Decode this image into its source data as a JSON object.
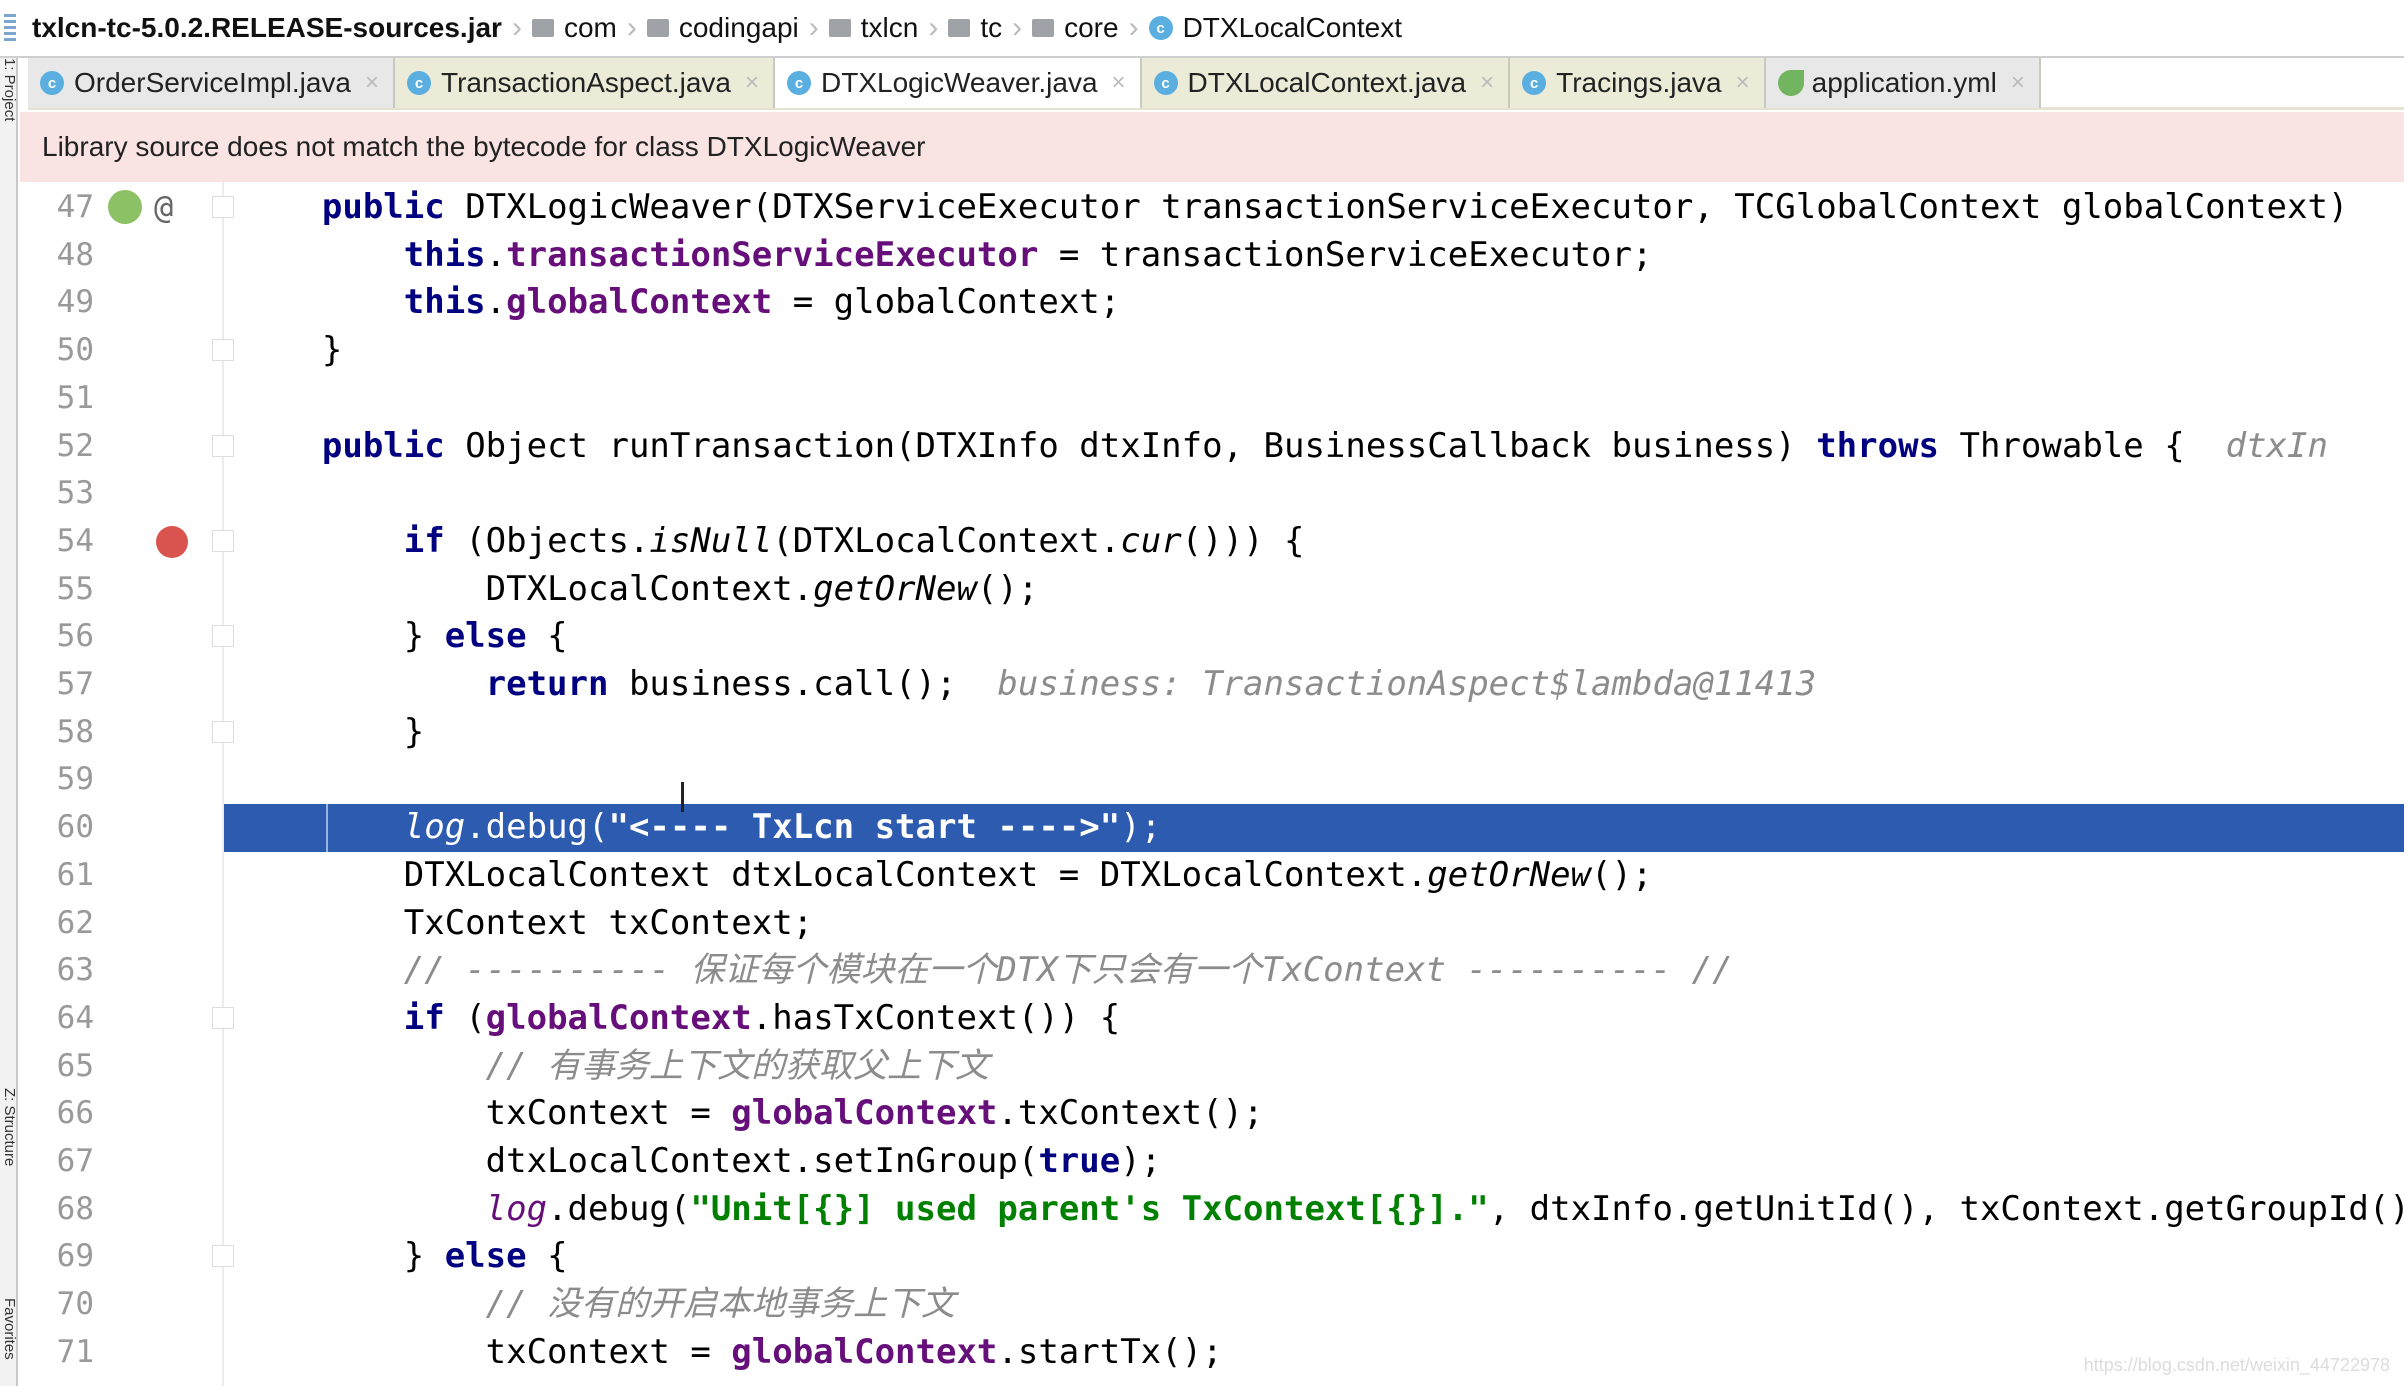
{
  "breadcrumb": {
    "items": [
      {
        "label": "txlcn-tc-5.0.2.RELEASE-sources.jar",
        "icon": "jar-icon"
      },
      {
        "label": "com",
        "icon": "folder-icon"
      },
      {
        "label": "codingapi",
        "icon": "folder-icon"
      },
      {
        "label": "txlcn",
        "icon": "folder-icon"
      },
      {
        "label": "tc",
        "icon": "folder-icon"
      },
      {
        "label": "core",
        "icon": "folder-icon"
      },
      {
        "label": "DTXLocalContext",
        "icon": "class-icon"
      }
    ]
  },
  "tabs": [
    {
      "label": "OrderServiceImpl.java",
      "icon": "class-icon",
      "active": false
    },
    {
      "label": "TransactionAspect.java",
      "icon": "class-icon",
      "active": false
    },
    {
      "label": "DTXLogicWeaver.java",
      "icon": "class-icon",
      "active": true
    },
    {
      "label": "DTXLocalContext.java",
      "icon": "class-icon",
      "active": false
    },
    {
      "label": "Tracings.java",
      "icon": "class-icon",
      "active": false
    },
    {
      "label": "application.yml",
      "icon": "yml-icon",
      "active": false
    }
  ],
  "close_glyph": "×",
  "class_glyph": "c",
  "side_tools": [
    "1: Project",
    "Z: Structure",
    "Favorites"
  ],
  "banner": "Library source does not match the bytecode for class DTXLogicWeaver",
  "editor": {
    "selected_line": 60,
    "colors": {
      "selection": "#2c5bb0",
      "keyword": "#000080",
      "field": "#660e7a",
      "string": "#008000",
      "comment": "#8c8c8c"
    },
    "lines": [
      {
        "n": 47,
        "fold": true,
        "icons": [
          "override-icon",
          "annotation-icon"
        ],
        "t": [
          [
            "    ",
            ""
          ],
          [
            "public",
            "kw"
          ],
          [
            " DTXLogicWeaver(DTXServiceExecutor transactionServiceExecutor, TCGlobalContext globalContext)",
            ""
          ]
        ]
      },
      {
        "n": 48,
        "t": [
          [
            "        ",
            ""
          ],
          [
            "this",
            "kw"
          ],
          [
            ".",
            ""
          ],
          [
            "transactionServiceExecutor",
            "fld"
          ],
          [
            " = transactionServiceExecutor;",
            ""
          ]
        ]
      },
      {
        "n": 49,
        "t": [
          [
            "        ",
            ""
          ],
          [
            "this",
            "kw"
          ],
          [
            ".",
            ""
          ],
          [
            "globalContext",
            "fld"
          ],
          [
            " = globalContext;",
            ""
          ]
        ]
      },
      {
        "n": 50,
        "fold": true,
        "t": [
          [
            "    }",
            ""
          ]
        ]
      },
      {
        "n": 51,
        "t": []
      },
      {
        "n": 52,
        "fold": true,
        "t": [
          [
            "    ",
            ""
          ],
          [
            "public",
            "kw"
          ],
          [
            " Object runTransaction(DTXInfo dtxInfo, BusinessCallback business) ",
            ""
          ],
          [
            "throws",
            "kw"
          ],
          [
            " Throwable {  ",
            ""
          ],
          [
            "dtxIn",
            "hint"
          ]
        ]
      },
      {
        "n": 53,
        "t": []
      },
      {
        "n": 54,
        "fold": true,
        "icons": [
          "breakpoint-icon"
        ],
        "t": [
          [
            "        ",
            ""
          ],
          [
            "if",
            "kw"
          ],
          [
            " (Objects.",
            ""
          ],
          [
            "isNull",
            "it"
          ],
          [
            "(DTXLocalContext.",
            ""
          ],
          [
            "cur",
            "it"
          ],
          [
            "())) {",
            ""
          ]
        ]
      },
      {
        "n": 55,
        "t": [
          [
            "            DTXLocalContext.",
            ""
          ],
          [
            "getOrNew",
            "it"
          ],
          [
            "();",
            ""
          ]
        ]
      },
      {
        "n": 56,
        "fold": true,
        "t": [
          [
            "        } ",
            ""
          ],
          [
            "else",
            "kw"
          ],
          [
            " {",
            ""
          ]
        ]
      },
      {
        "n": 57,
        "t": [
          [
            "            ",
            ""
          ],
          [
            "return",
            "kw"
          ],
          [
            " business.call();  ",
            ""
          ],
          [
            "business: TransactionAspect$lambda@11413",
            "hint"
          ]
        ]
      },
      {
        "n": 58,
        "fold": true,
        "t": [
          [
            "        }",
            ""
          ]
        ]
      },
      {
        "n": 59,
        "t": []
      },
      {
        "n": 60,
        "t": [
          [
            "        ",
            ""
          ],
          [
            "log",
            "ifld"
          ],
          [
            ".debug(",
            ""
          ],
          [
            "\"<---- TxLcn start ---->\"",
            "str"
          ],
          [
            ");",
            ""
          ]
        ]
      },
      {
        "n": 61,
        "t": [
          [
            "        DTXLocalContext dtxLocalContext = DTXLocalContext.",
            ""
          ],
          [
            "getOrNew",
            "it"
          ],
          [
            "();",
            ""
          ]
        ]
      },
      {
        "n": 62,
        "t": [
          [
            "        TxContext txContext;",
            ""
          ]
        ]
      },
      {
        "n": 63,
        "t": [
          [
            "        ",
            ""
          ],
          [
            "// ---------- 保证每个模块在一个DTX下只会有一个TxContext ---------- //",
            "cm"
          ]
        ]
      },
      {
        "n": 64,
        "fold": true,
        "t": [
          [
            "        ",
            ""
          ],
          [
            "if",
            "kw"
          ],
          [
            " (",
            ""
          ],
          [
            "globalContext",
            "fld"
          ],
          [
            ".hasTxContext()) {",
            ""
          ]
        ]
      },
      {
        "n": 65,
        "t": [
          [
            "            ",
            ""
          ],
          [
            "// 有事务上下文的获取父上下文",
            "cm"
          ]
        ]
      },
      {
        "n": 66,
        "t": [
          [
            "            txContext = ",
            ""
          ],
          [
            "globalContext",
            "fld"
          ],
          [
            ".txContext();",
            ""
          ]
        ]
      },
      {
        "n": 67,
        "t": [
          [
            "            dtxLocalContext.setInGroup(",
            ""
          ],
          [
            "true",
            "kw"
          ],
          [
            ");",
            ""
          ]
        ]
      },
      {
        "n": 68,
        "t": [
          [
            "            ",
            ""
          ],
          [
            "log",
            "ifld"
          ],
          [
            ".debug(",
            ""
          ],
          [
            "\"Unit[{}] used parent's TxContext[{}].\"",
            "str"
          ],
          [
            ", dtxInfo.getUnitId(), txContext.getGroupId());",
            ""
          ]
        ]
      },
      {
        "n": 69,
        "fold": true,
        "t": [
          [
            "        } ",
            ""
          ],
          [
            "else",
            "kw"
          ],
          [
            " {",
            ""
          ]
        ]
      },
      {
        "n": 70,
        "t": [
          [
            "            ",
            ""
          ],
          [
            "// 没有的开启本地事务上下文",
            "cm"
          ]
        ]
      },
      {
        "n": 71,
        "t": [
          [
            "            txContext = ",
            ""
          ],
          [
            "globalContext",
            "fld"
          ],
          [
            ".startTx();",
            ""
          ]
        ]
      }
    ]
  },
  "watermark": "https://blog.csdn.net/weixin_44722978"
}
